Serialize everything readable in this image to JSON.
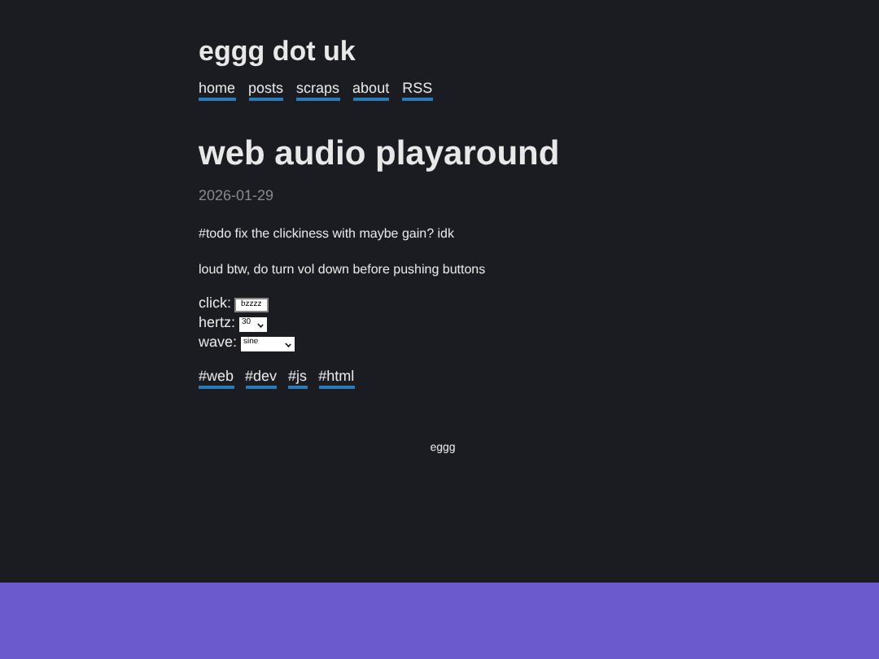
{
  "site_title": "eggg dot uk",
  "nav": [
    "home",
    "posts",
    "scraps",
    "about",
    "RSS"
  ],
  "post": {
    "title": "web audio playaround",
    "date": "2026-01-29",
    "paragraphs": [
      "#todo fix the clickiness with maybe gain? idk",
      "loud btw, do turn vol down before pushing buttons"
    ],
    "controls": [
      {
        "kind": "button",
        "label": "click:",
        "value": "bzzzz"
      },
      {
        "kind": "select",
        "label": "hertz:",
        "value": "30"
      },
      {
        "kind": "select",
        "label": "wave:",
        "value": "sine"
      }
    ],
    "tags": [
      "#web",
      "#dev",
      "#js",
      "#html"
    ]
  },
  "footer": "eggg"
}
